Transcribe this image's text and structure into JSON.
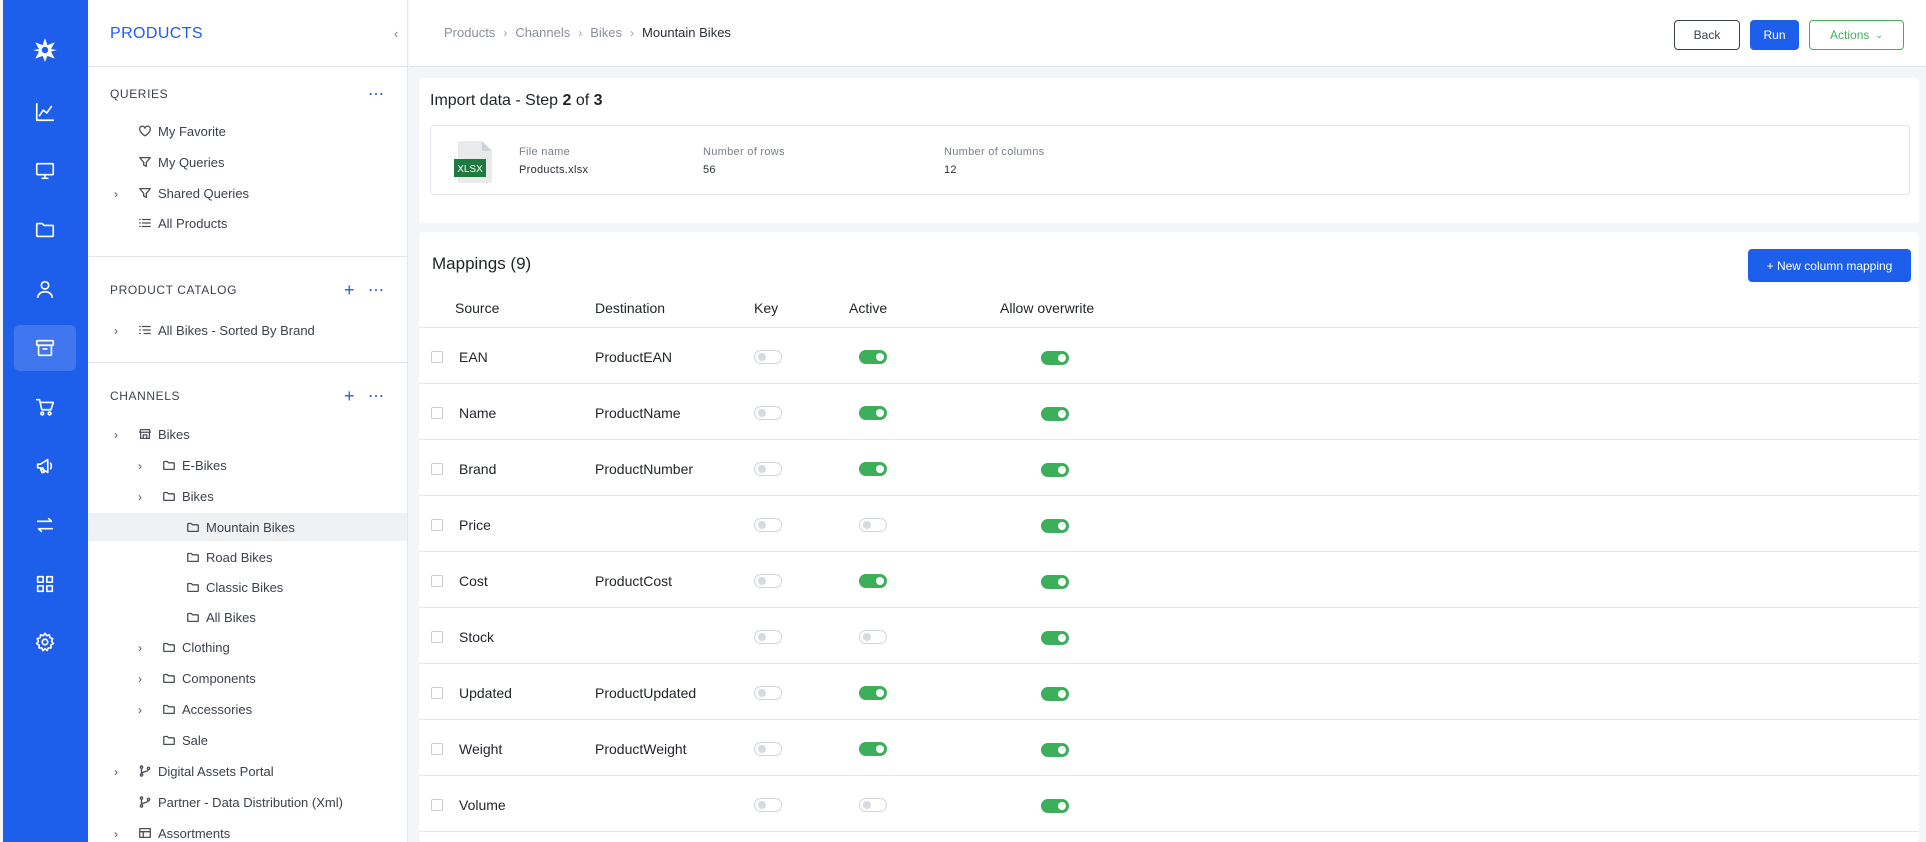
{
  "sidebar": {
    "title": "PRODUCTS",
    "queries": {
      "title": "QUERIES",
      "items": [
        {
          "label": "My Favorite"
        },
        {
          "label": "My Queries"
        },
        {
          "label": "Shared Queries"
        },
        {
          "label": "All Products"
        }
      ]
    },
    "catalog": {
      "title": "PRODUCT CATALOG",
      "items": [
        {
          "label": "All Bikes - Sorted By Brand"
        }
      ]
    },
    "channels": {
      "title": "CHANNELS",
      "items": [
        {
          "label": "Bikes"
        },
        {
          "label": "E-Bikes"
        },
        {
          "label": "Bikes"
        },
        {
          "label": "Mountain Bikes"
        },
        {
          "label": "Road Bikes"
        },
        {
          "label": "Classic Bikes"
        },
        {
          "label": "All Bikes"
        },
        {
          "label": "Clothing"
        },
        {
          "label": "Components"
        },
        {
          "label": "Accessories"
        },
        {
          "label": "Sale"
        },
        {
          "label": "Digital Assets Portal"
        },
        {
          "label": "Partner - Data Distribution (Xml)"
        },
        {
          "label": "Assortments"
        }
      ]
    }
  },
  "breadcrumb": [
    "Products",
    "Channels",
    "Bikes",
    "Mountain Bikes"
  ],
  "toolbar": {
    "back": "Back",
    "run": "Run",
    "actions": "Actions"
  },
  "import": {
    "title_prefix": "Import data - Step ",
    "step": "2",
    "of": " of ",
    "total": "3",
    "file_icon_text": "XLSX",
    "file_name_label": "File name",
    "file_name": "Products.xlsx",
    "rows_label": "Number of rows",
    "rows": "56",
    "cols_label": "Number of columns",
    "cols": "12"
  },
  "mappings": {
    "title": "Mappings (9)",
    "new_button": "+ New column mapping",
    "columns": [
      "Source",
      "Destination",
      "Key",
      "Active",
      "Allow overwrite"
    ],
    "rows": [
      {
        "source": "EAN",
        "destination": "ProductEAN",
        "key": false,
        "active": true,
        "overwrite": true
      },
      {
        "source": "Name",
        "destination": "ProductName",
        "key": false,
        "active": true,
        "overwrite": true
      },
      {
        "source": "Brand",
        "destination": "ProductNumber",
        "key": false,
        "active": true,
        "overwrite": true
      },
      {
        "source": "Price",
        "destination": "",
        "key": false,
        "active": false,
        "overwrite": true
      },
      {
        "source": "Cost",
        "destination": "ProductCost",
        "key": false,
        "active": true,
        "overwrite": true
      },
      {
        "source": "Stock",
        "destination": "",
        "key": false,
        "active": false,
        "overwrite": true
      },
      {
        "source": "Updated",
        "destination": "ProductUpdated",
        "key": false,
        "active": true,
        "overwrite": true
      },
      {
        "source": "Weight",
        "destination": "ProductWeight",
        "key": false,
        "active": true,
        "overwrite": true
      },
      {
        "source": "Volume",
        "destination": "",
        "key": false,
        "active": false,
        "overwrite": true
      }
    ]
  },
  "colors": {
    "primary": "#1d5eeb",
    "toggle_on": "#3cae5c",
    "actions": "#43b05c"
  }
}
